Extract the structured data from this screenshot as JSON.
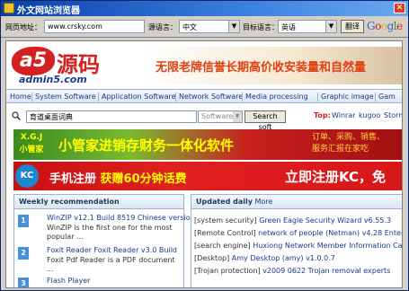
{
  "window": {
    "title": "外文网站浏览器",
    "close_glyph": "✕"
  },
  "toolbar": {
    "url_label": "网页地址：",
    "url_value": "www.crsky.com",
    "source_label": "源语言：",
    "source_value": "中文",
    "target_label": "目标语言：",
    "target_value": "英语",
    "translate_label": "翻译",
    "google_logo": "Google"
  },
  "page": {
    "logo_mark": "a5",
    "logo_cn": "源码",
    "logo_url": "admin5.com",
    "header_banner": "无限老牌信誉长期高价收安装量和自然量",
    "nav": [
      "Home",
      "System Software",
      "Application Software",
      "Network Software",
      "Media processing",
      "Graphic image",
      "Gam"
    ],
    "search": {
      "value": "育道桌面词典",
      "select_value": "Software",
      "button_label": "Search soft",
      "top_label": "Top:",
      "top_links": [
        "Winrar",
        "kugoo",
        "Storm"
      ]
    },
    "ad1": {
      "brand": "X.G.J 小管家",
      "text": "小管家进销存财务一体化软件",
      "side": "订单、采购、销售、\n服务汇报在家吃"
    },
    "ad2": {
      "logo": "KC",
      "text_a": "手机注册",
      "text_b": "获赠60分钟话费",
      "right": "立即注册KC，免"
    },
    "weekly": {
      "title": "Weekly recommendation",
      "items": [
        {
          "num": "1",
          "title": "WinZIP v12.1 Build 8519 Chinese version",
          "desc": "WinZIP is the first one for the most popular ..."
        },
        {
          "num": "2",
          "title": "Foxit Reader Foxit Reader v3.0 Build",
          "desc": "Foxit Pdf Reader is a PDF document ..."
        },
        {
          "num": "3",
          "title": "Flash Player",
          "desc": ""
        }
      ]
    },
    "daily": {
      "title": "Updated daily",
      "more": "More",
      "items": [
        {
          "cat": "[system security]",
          "text": "Green Eagle Security Wizard v6.55.3"
        },
        {
          "cat": "[Remote Control]",
          "text": "network of people (Netman) v4.28 Enterprise"
        },
        {
          "cat": "[search engine]",
          "text": "Huxiong Network Member Information Capture"
        },
        {
          "cat": "[Desktop]",
          "text": "Amy Desktop (amy) v1.0.0.7"
        },
        {
          "cat": "[Trojan protection]",
          "text": "v2009 0622 Trojan removal experts"
        }
      ]
    }
  }
}
